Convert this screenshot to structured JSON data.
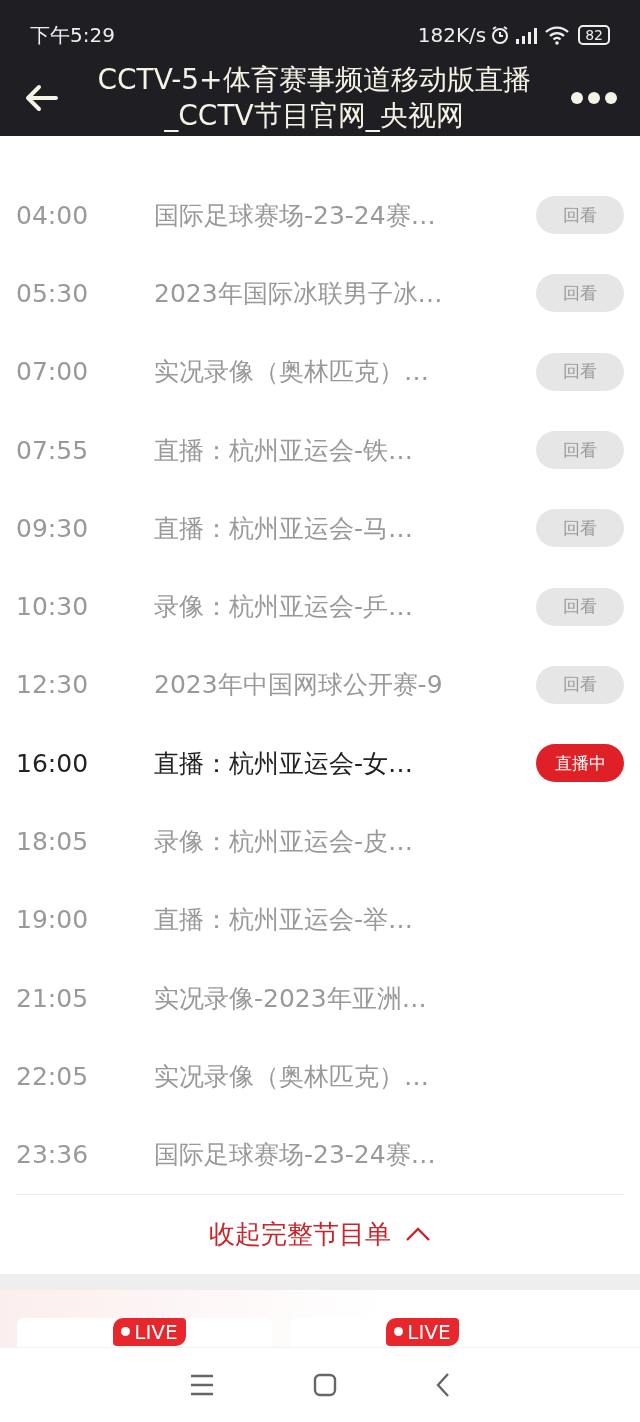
{
  "status_bar": {
    "time": "下午5:29",
    "speed": "182K/s",
    "battery": "82"
  },
  "header": {
    "title": "CCTV-5+体育赛事频道移动版直播_CCTV节目官网_央视网"
  },
  "schedule": [
    {
      "time": "04:00",
      "title": "国际足球赛场-23-24赛…",
      "current": false,
      "action": {
        "kind": "replay",
        "label": "回看"
      }
    },
    {
      "time": "05:30",
      "title": "2023年国际冰联男子冰…",
      "current": false,
      "action": {
        "kind": "replay",
        "label": "回看"
      }
    },
    {
      "time": "07:00",
      "title": "实况录像（奥林匹克）…",
      "current": false,
      "action": {
        "kind": "replay",
        "label": "回看"
      }
    },
    {
      "time": "07:55",
      "title": "直播：杭州亚运会-铁…",
      "current": false,
      "action": {
        "kind": "replay",
        "label": "回看"
      }
    },
    {
      "time": "09:30",
      "title": "直播：杭州亚运会-马…",
      "current": false,
      "action": {
        "kind": "replay",
        "label": "回看"
      }
    },
    {
      "time": "10:30",
      "title": "录像：杭州亚运会-乒…",
      "current": false,
      "action": {
        "kind": "replay",
        "label": "回看"
      }
    },
    {
      "time": "12:30",
      "title": "2023年中国网球公开赛-9",
      "current": false,
      "action": {
        "kind": "replay",
        "label": "回看"
      }
    },
    {
      "time": "16:00",
      "title": "直播：杭州亚运会-女…",
      "current": true,
      "action": {
        "kind": "live",
        "label": "直播中"
      }
    },
    {
      "time": "18:05",
      "title": "录像：杭州亚运会-皮…",
      "current": false
    },
    {
      "time": "19:00",
      "title": "直播：杭州亚运会-举…",
      "current": false
    },
    {
      "time": "21:05",
      "title": "实况录像-2023年亚洲…",
      "current": false
    },
    {
      "time": "22:05",
      "title": "实况录像（奥林匹克）…",
      "current": false
    },
    {
      "time": "23:36",
      "title": "国际足球赛场-23-24赛…",
      "current": false
    }
  ],
  "collapse_button": {
    "label": "收起完整节目单"
  },
  "live_cards": [
    {
      "badge": "LIVE"
    },
    {
      "badge": "LIVE"
    }
  ]
}
